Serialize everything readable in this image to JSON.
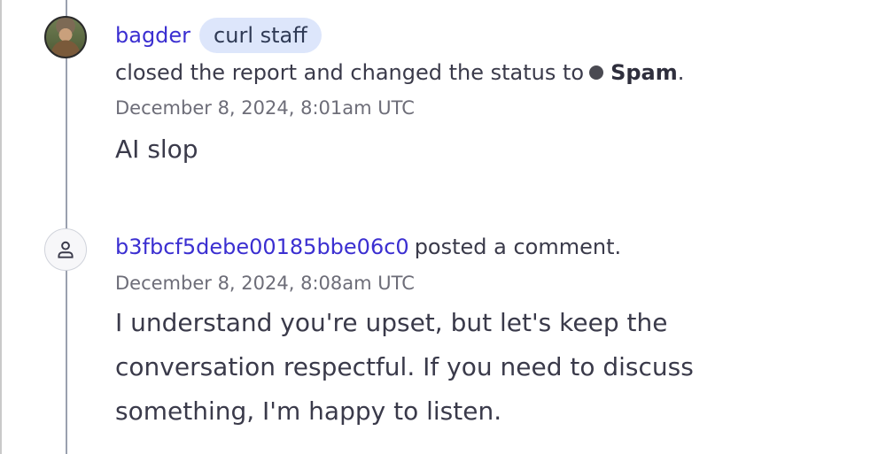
{
  "activities": [
    {
      "username": "bagder",
      "badge": "curl staff",
      "action": "closed the report and changed the status to",
      "status": "Spam",
      "status_suffix": ".",
      "timestamp": "December 8, 2024, 8:01am UTC",
      "body": "AI slop"
    },
    {
      "username": "b3fbcf5debe00185bbe06c0",
      "action": "posted a comment.",
      "timestamp": "December 8, 2024, 8:08am UTC",
      "body": "I understand you're upset, but let's keep the conversation respectful. If you need to discuss something, I'm happy to listen."
    }
  ],
  "colors": {
    "link": "#3b2fd1",
    "badge_bg": "#dde6fb",
    "status_dot": "#4a4a52",
    "timeline": "#9aa0ae"
  }
}
